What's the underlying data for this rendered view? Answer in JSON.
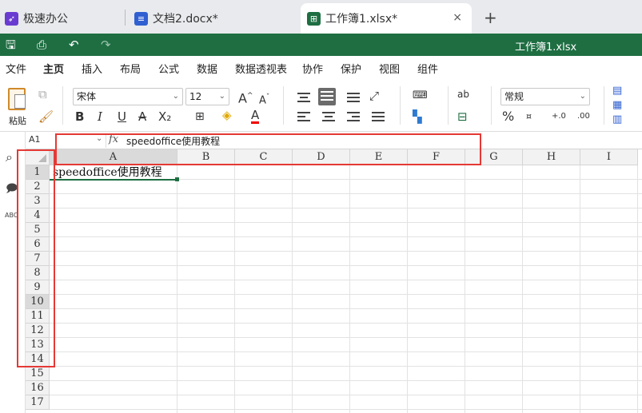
{
  "tabs": [
    {
      "label": "极速办公",
      "icon": "rocket-icon",
      "color": "#6a3bd1"
    },
    {
      "label": "文档2.docx*",
      "icon": "document-icon",
      "color": "#2f5fd1"
    },
    {
      "label": "工作簿1.xlsx*",
      "icon": "spreadsheet-icon",
      "color": "#1e6e42",
      "active": true
    }
  ],
  "new_tab": "+",
  "close": "×",
  "title_bar": {
    "doc_title": "工作簿1.xlsx",
    "color": "#1e6e42"
  },
  "menu": [
    "文件",
    "主页",
    "插入",
    "布局",
    "公式",
    "数据",
    "数据透视表",
    "协作",
    "保护",
    "视图",
    "组件"
  ],
  "ribbon": {
    "paste_label": "粘贴",
    "font_name": "宋体",
    "font_size": "12",
    "number_format": "常规",
    "bold": "B",
    "italic": "I",
    "underline": "U",
    "strike": "A",
    "subscript": "X₂",
    "grow_font": "A",
    "shrink_font": "A",
    "percent": "%"
  },
  "formula_bar": {
    "cell_ref": "A1",
    "fx": "fx",
    "content": "speedoffice使用教程"
  },
  "columns": [
    "A",
    "B",
    "C",
    "D",
    "E",
    "F",
    "G",
    "H",
    "I"
  ],
  "rows": [
    "1",
    "2",
    "3",
    "4",
    "5",
    "6",
    "7",
    "8",
    "9",
    "10",
    "11",
    "12",
    "13",
    "14",
    "15",
    "16",
    "17"
  ],
  "cells": {
    "A1": "speedoffice使用教程"
  },
  "annotation_color": "#e53935"
}
